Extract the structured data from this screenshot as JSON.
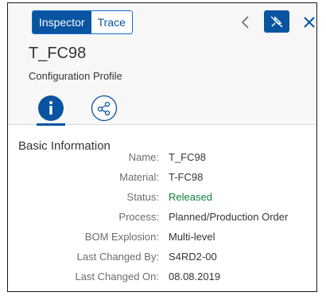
{
  "header": {
    "tabs": [
      {
        "label": "Inspector",
        "active": true
      },
      {
        "label": "Trace",
        "active": false
      }
    ],
    "actions": {
      "back_icon": "chevron-left-icon",
      "pin_icon": "unpin-icon",
      "close_icon": "close-icon"
    },
    "object": {
      "title": "T_FC98",
      "subtitle": "Configuration Profile"
    },
    "icon_tabs": [
      {
        "icon": "info-icon",
        "selected": true
      },
      {
        "icon": "relationship-icon",
        "selected": false
      }
    ]
  },
  "section": {
    "title": "Basic Information"
  },
  "properties": [
    {
      "label": "Name:",
      "value": "T_FC98"
    },
    {
      "label": "Material:",
      "value": "T-FC98"
    },
    {
      "label": "Status:",
      "value": "Released"
    },
    {
      "label": "Process:",
      "value": "Planned/Production Order"
    },
    {
      "label": "BOM Explosion:",
      "value": "Multi-level"
    },
    {
      "label": "Last Changed By:",
      "value": "S4RD2-00"
    },
    {
      "label": "Last Changed On:",
      "value": "08.08.2019"
    }
  ],
  "colors": {
    "accent": "#0854a0",
    "positive": "#107e3e",
    "label": "#6a6d70",
    "text": "#32363a"
  }
}
